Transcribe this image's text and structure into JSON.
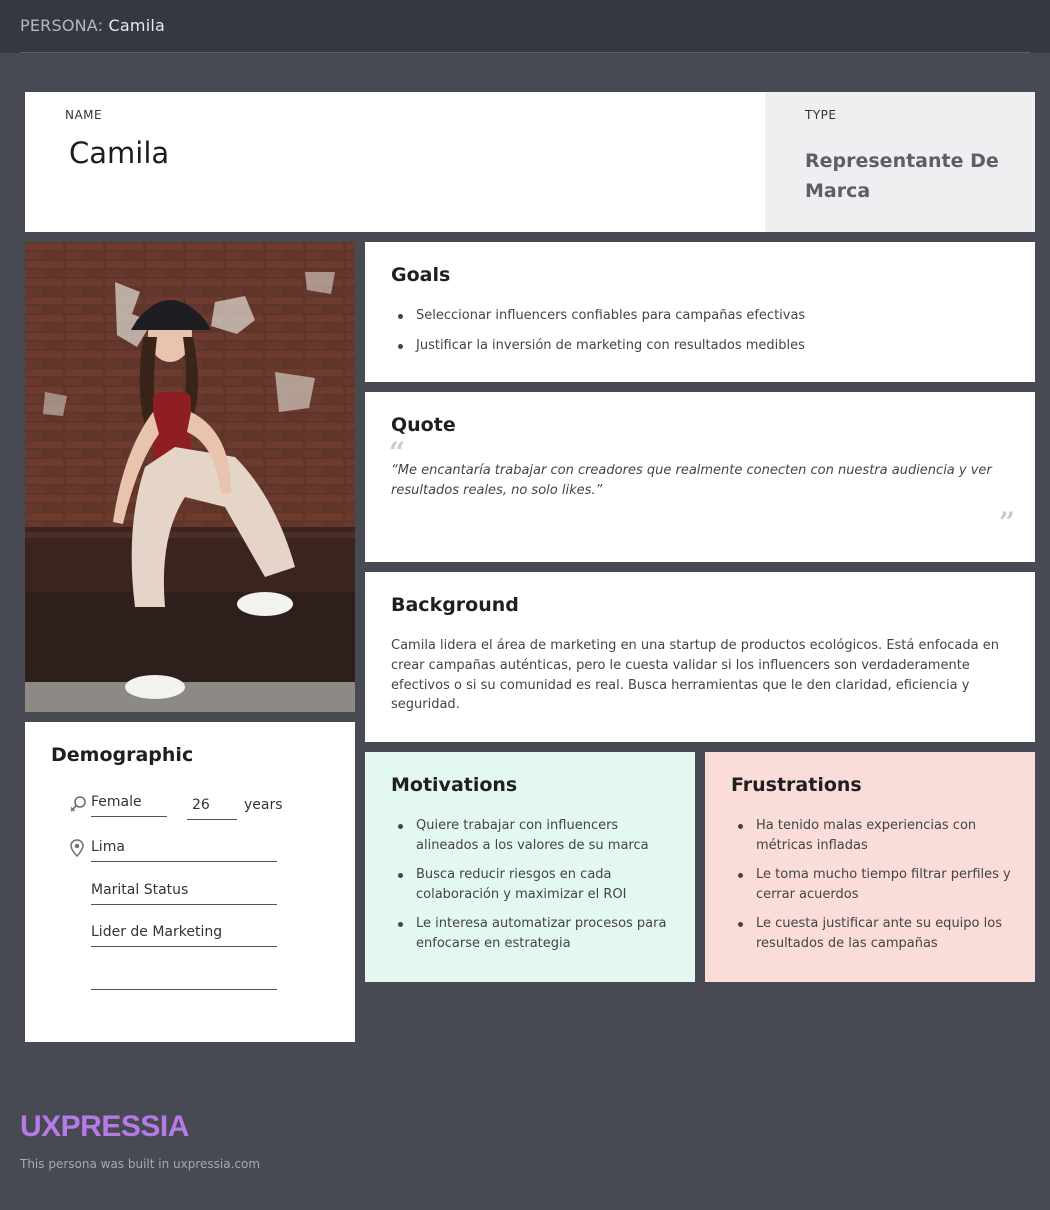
{
  "header": {
    "prefix": "PERSONA:",
    "name": "Camila"
  },
  "profile": {
    "name_label": "NAME",
    "name": "Camila",
    "type_label": "TYPE",
    "type": "Representante De Marca"
  },
  "goals": {
    "title": "Goals",
    "items": [
      "Seleccionar influencers confiables para campañas efectivas",
      "Justificar la inversión de marketing con resultados medibles"
    ]
  },
  "quote": {
    "title": "Quote",
    "text": "“Me encantaría trabajar con creadores que realmente conecten con nuestra audiencia y ver resultados reales, no solo likes.”"
  },
  "background": {
    "title": "Background",
    "text": "Camila lidera el área de marketing en una startup de productos ecológicos. Está enfocada en crear campañas auténticas, pero le cuesta validar si los influencers son verdaderamente efectivos o si su comunidad es real. Busca herramientas que le den claridad, eficiencia y seguridad."
  },
  "demographic": {
    "title": "Demographic",
    "gender": "Female",
    "age": "26",
    "age_unit": "years",
    "location": "Lima",
    "marital_status": "Marital Status",
    "occupation": "Lider de Marketing",
    "extra": ""
  },
  "motivations": {
    "title": "Motivations",
    "items": [
      "Quiere trabajar con influencers alineados a los valores de su marca",
      "Busca reducir riesgos en cada colaboración y maximizar el ROI",
      "Le interesa automatizar procesos para enfocarse en estrategia"
    ]
  },
  "frustrations": {
    "title": "Frustrations",
    "items": [
      "Ha tenido malas experiencias con métricas infladas",
      "Le toma mucho tiempo filtrar perfiles y cerrar acuerdos",
      "Le cuesta justificar ante su equipo los resultados de las campañas"
    ]
  },
  "footer": {
    "brand": "UXPRESSIA",
    "note": "This persona was built in uxpressia.com"
  },
  "colors": {
    "page_bg": "#474a53",
    "topbar_bg": "#343840",
    "type_card_bg": "#efeff1",
    "motivations_bg": "#e3f7f3",
    "frustrations_bg": "#fadcd9",
    "brand": "#b57ae6"
  },
  "icons": [
    "gender-icon",
    "location-pin-icon",
    "open-quote-icon",
    "close-quote-icon"
  ]
}
